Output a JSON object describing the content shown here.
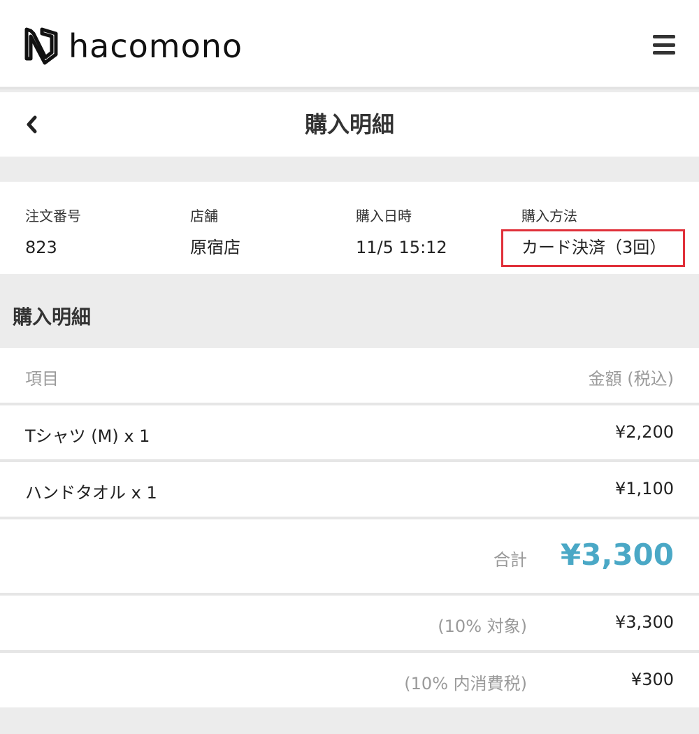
{
  "header": {
    "logo_text": "hacomono",
    "menu_icon": "hamburger-menu-icon"
  },
  "titlebar": {
    "title": "購入明細",
    "back_icon": "chevron-left-icon"
  },
  "order_info": {
    "order_number": {
      "label": "注文番号",
      "value": "823"
    },
    "store": {
      "label": "店舗",
      "value": "原宿店"
    },
    "purchase_datetime": {
      "label": "購入日時",
      "value": "11/5 15:12"
    },
    "payment_method": {
      "label": "購入方法",
      "value": "カード決済（3回）"
    }
  },
  "details": {
    "section_title": "購入明細",
    "columns": {
      "item": "項目",
      "amount": "金額 (税込)"
    },
    "items": [
      {
        "name": "Tシャツ (M) x 1",
        "price": "¥2,200"
      },
      {
        "name": "ハンドタオル x 1",
        "price": "¥1,100"
      }
    ],
    "total": {
      "label": "合計",
      "value": "¥3,300"
    },
    "tax_target": {
      "label": "(10% 対象)",
      "value": "¥3,300"
    },
    "tax_included": {
      "label": "(10% 内消費税)",
      "value": "¥300"
    }
  },
  "colors": {
    "accent": "#4aa8c6",
    "highlight_border": "#e0303a"
  }
}
